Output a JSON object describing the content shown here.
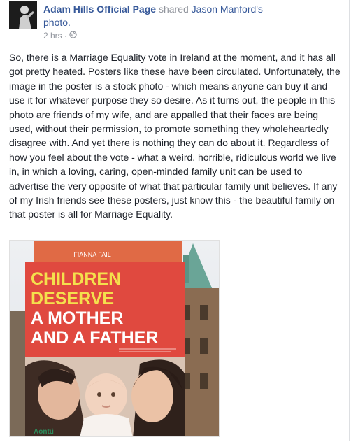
{
  "header": {
    "page_name": "Adam Hills Official Page",
    "action_text": "shared",
    "shared_author": "Jason Manford's",
    "shared_object": "photo.",
    "timestamp": "2 hrs",
    "separator": "·",
    "privacy_icon": "globe-icon"
  },
  "post": {
    "body": "So, there is a Marriage Equality vote in Ireland at the moment, and it has all got pretty heated. Posters like these have been circulated. Unfortunately, the image in the poster is a stock photo - which means anyone can buy it and use it for whatever purpose they so desire. As it turns out, the people in this photo are friends of my wife, and are appalled that their faces are being used, without their permission, to promote something they wholeheartedly disagree with. And yet there is nothing they can do about it. Regardless of how you feel about the vote - what a weird, horrible, ridiculous world we live in, in which a loving, caring, open-minded family unit can be used to advertise the very opposite of what that particular family unit believes. If any of my Irish friends see these posters, just know this - the beautiful family on that poster is all for Marriage Equality."
  },
  "poster": {
    "party": "FIANNA FAIL",
    "line1": "CHILDREN",
    "line2": "DESERVE",
    "line3": "A MOTHER",
    "line4": "AND A FATHER",
    "small_print": "Protect the right of a child to a mother and a father",
    "logo": "Aontú"
  },
  "colors": {
    "link": "#365899",
    "meta": "#90949c",
    "text": "#1d2129",
    "poster_red": "#e0493f",
    "poster_yellow": "#f4e04d"
  }
}
